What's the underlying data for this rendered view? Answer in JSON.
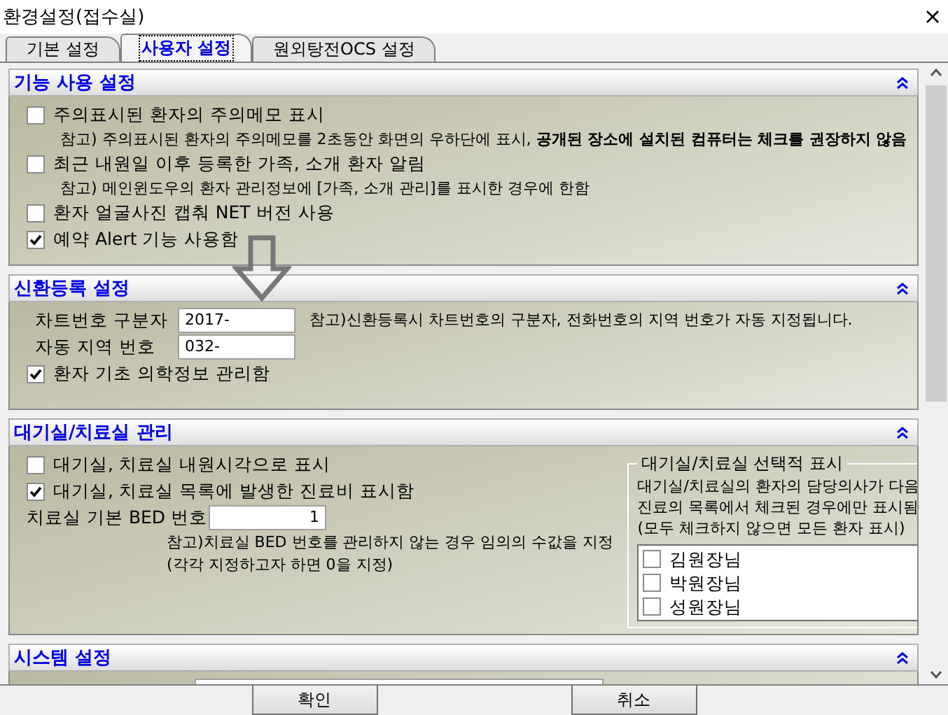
{
  "window": {
    "title": "환경설정(접수실)"
  },
  "tabs": [
    {
      "label": "기본 설정",
      "selected": false
    },
    {
      "label": "사용자 설정",
      "selected": true
    },
    {
      "label": "원외탕전OCS 설정",
      "selected": false
    }
  ],
  "sections": [
    {
      "title": "기능 사용 설정",
      "items": [
        {
          "kind": "checkbox",
          "label": "주의표시된 환자의 주의메모 표시",
          "checked": false,
          "note": "참고) 주의표시된 환자의 주의메모를 2초동안 화면의 우하단에 표시, **공개된 장소에 설치된 컴퓨터는 체크를 권장하지 않음**"
        },
        {
          "kind": "checkbox",
          "label": "최근 내원일 이후 등록한 가족, 소개 환자 알림",
          "checked": false,
          "note": "참고) 메인윈도우의 환자 관리정보에 [가족, 소개 관리]를 표시한 경우에 한함"
        },
        {
          "kind": "checkbox",
          "label": "환자 얼굴사진 캡춰 NET 버전 사용",
          "checked": false
        },
        {
          "kind": "checkbox",
          "label": "예약 Alert 기능 사용함",
          "checked": true
        }
      ]
    },
    {
      "title": "신환등록 설정",
      "items": [
        {
          "kind": "field",
          "label": "차트번호 구분자",
          "value": "2017-",
          "note": "참고)신환등록시 차트번호의 구분자, 전화번호의 지역 번호가 자동 지정됩니다."
        },
        {
          "kind": "field",
          "label": "자동 지역 번호",
          "value": "032-"
        },
        {
          "kind": "checkbox",
          "label": "환자 기초 의학정보 관리함",
          "checked": true
        }
      ]
    },
    {
      "title": "대기실/치료실 관리",
      "items": [
        {
          "kind": "checkbox",
          "label": "대기실, 치료실 내원시각으로 표시",
          "checked": false
        },
        {
          "kind": "checkbox",
          "label": "대기실, 치료실 목록에 발생한 진료비 표시함",
          "checked": true
        },
        {
          "kind": "number",
          "label": "치료실 기본 BED 번호",
          "value": "1",
          "notes": [
            "참고)치료실 BED 번호를 관리하지 않는 경우 임의의 수값을 지정",
            "(각각 지정하고자 하면 0을 지정)"
          ]
        }
      ],
      "group": {
        "title": "대기실/치료실 선택적 표시",
        "lines": [
          "대기실/치료실의 환자의 담당의사가 다음",
          "진료의 목록에서 체크된 경우에만 표시됨",
          "(모두 체크하지 않으면 모든 환자 표시)"
        ],
        "doctors": [
          {
            "name": "김원장님",
            "checked": false
          },
          {
            "name": "박원장님",
            "checked": false
          },
          {
            "name": "성원장님",
            "checked": false
          }
        ]
      }
    },
    {
      "title": "시스템 설정",
      "items": [
        {
          "kind": "cut"
        }
      ]
    }
  ],
  "buttons": [
    "확인",
    "취소"
  ]
}
